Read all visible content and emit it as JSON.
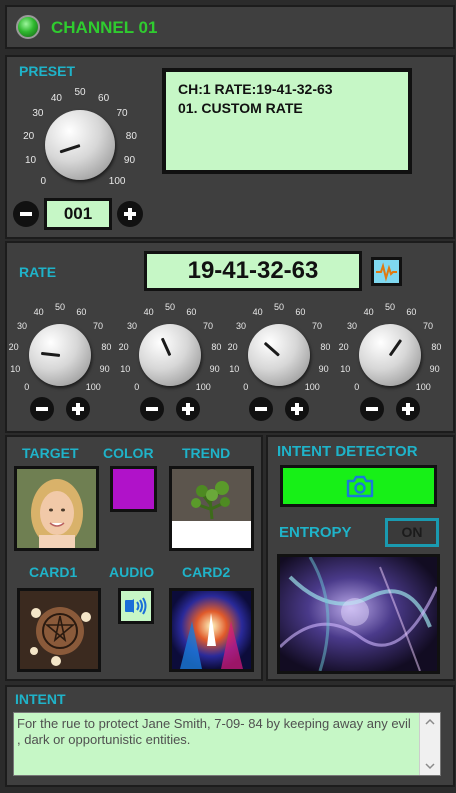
{
  "header": {
    "title": "CHANNEL 01",
    "led_color": "#2fb82f"
  },
  "preset": {
    "label": "PRESET",
    "scale_labels": [
      "0",
      "10",
      "20",
      "30",
      "40",
      "50",
      "60",
      "70",
      "80",
      "90",
      "100"
    ],
    "knob_value": 10,
    "counter": "001",
    "display_line1": "CH:1  RATE:19-41-32-63",
    "display_line2": "01. CUSTOM RATE"
  },
  "rate": {
    "label": "RATE",
    "value": "19-41-32-63",
    "scale_labels": [
      "0",
      "10",
      "20",
      "30",
      "40",
      "50",
      "60",
      "70",
      "80",
      "90",
      "100"
    ],
    "knobs": [
      19,
      41,
      32,
      63
    ]
  },
  "media": {
    "target_label": "TARGET",
    "color_label": "COLOR",
    "trend_label": "TREND",
    "card1_label": "CARD1",
    "audio_label": "AUDIO",
    "card2_label": "CARD2",
    "color_value": "#b012c9"
  },
  "intent_detector": {
    "label": "INTENT DETECTOR",
    "entropy_label": "ENTROPY",
    "entropy_toggle": "ON",
    "detector_color": "#17f017"
  },
  "intent": {
    "label": "INTENT",
    "text": "For the rue  to protect Jane Smith, 7-09- 84 by keeping away any evil , dark or opportunistic entities."
  },
  "colors": {
    "accent": "#1fb3c9",
    "lcd": "#c6f7c6",
    "panel": "#3f3f3f"
  }
}
